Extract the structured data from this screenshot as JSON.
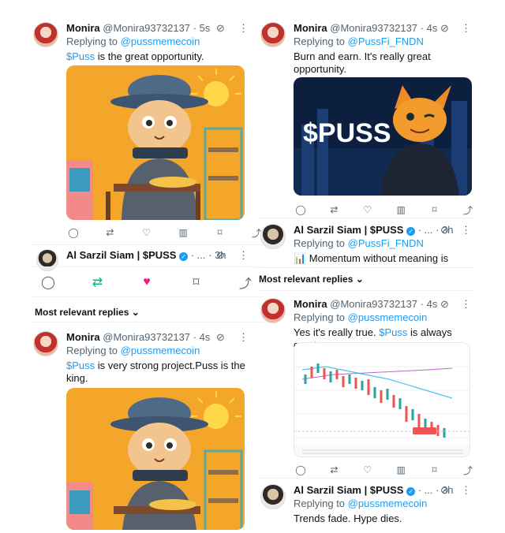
{
  "left_col": {
    "tweet1": {
      "name": "Monira",
      "handle": "@Monira93732137",
      "time": "· 5s",
      "replying_prefix": "Replying to",
      "replying_to": "@pussmemecoin",
      "tag": "$Puss",
      "text": " is the great opportunity."
    },
    "siam_header": {
      "name": "Al Sarzil Siam | $PUSS",
      "time": "· ... · 3h"
    },
    "section_label": "Most relevant replies",
    "tweet2": {
      "name": "Monira",
      "handle": "@Monira93732137",
      "time": "· 4s",
      "replying_prefix": "Replying to",
      "replying_to": "@pussmemecoin",
      "tag": "$Puss",
      "text": " is very strong project.Puss is the king."
    }
  },
  "right_col": {
    "tweet1": {
      "name": "Monira",
      "handle": "@Monira93732137",
      "time": "· 4s",
      "replying_prefix": "Replying to",
      "replying_to": "@PussFi_FNDN",
      "text": "Burn and earn. It's really great opportunity.",
      "image_text": "$PUSS"
    },
    "tweet2": {
      "name": "Al Sarzil Siam | $PUSS",
      "time": "· ... · 3h",
      "replying_prefix": "Replying to",
      "replying_to": "@PussFi_FNDN",
      "text": "📊 Momentum without meaning is"
    },
    "section_label": "Most relevant replies",
    "tweet3": {
      "name": "Monira",
      "handle": "@Monira93732137",
      "time": "· 4s",
      "replying_prefix": "Replying to",
      "replying_to": "@pussmemecoin",
      "text_a": "Yes it's really true. ",
      "tag": "$Puss",
      "text_b": " is always great."
    },
    "tweet4": {
      "name": "Al Sarzil Siam | $PUSS",
      "time": "· ... · 3h",
      "replying_prefix": "Replying to",
      "replying_to": "@pussmemecoin",
      "text": "Trends fade. Hype dies."
    }
  },
  "colors": {
    "accent": "#1d9bf0",
    "like": "#f91880",
    "retweet": "#00ba7c",
    "muted": "#536471"
  },
  "icons": [
    "reply-icon",
    "retweet-icon",
    "like-icon",
    "views-icon",
    "bookmark-icon",
    "share-icon",
    "grok-icon",
    "more-icon",
    "chevron-down-icon"
  ]
}
